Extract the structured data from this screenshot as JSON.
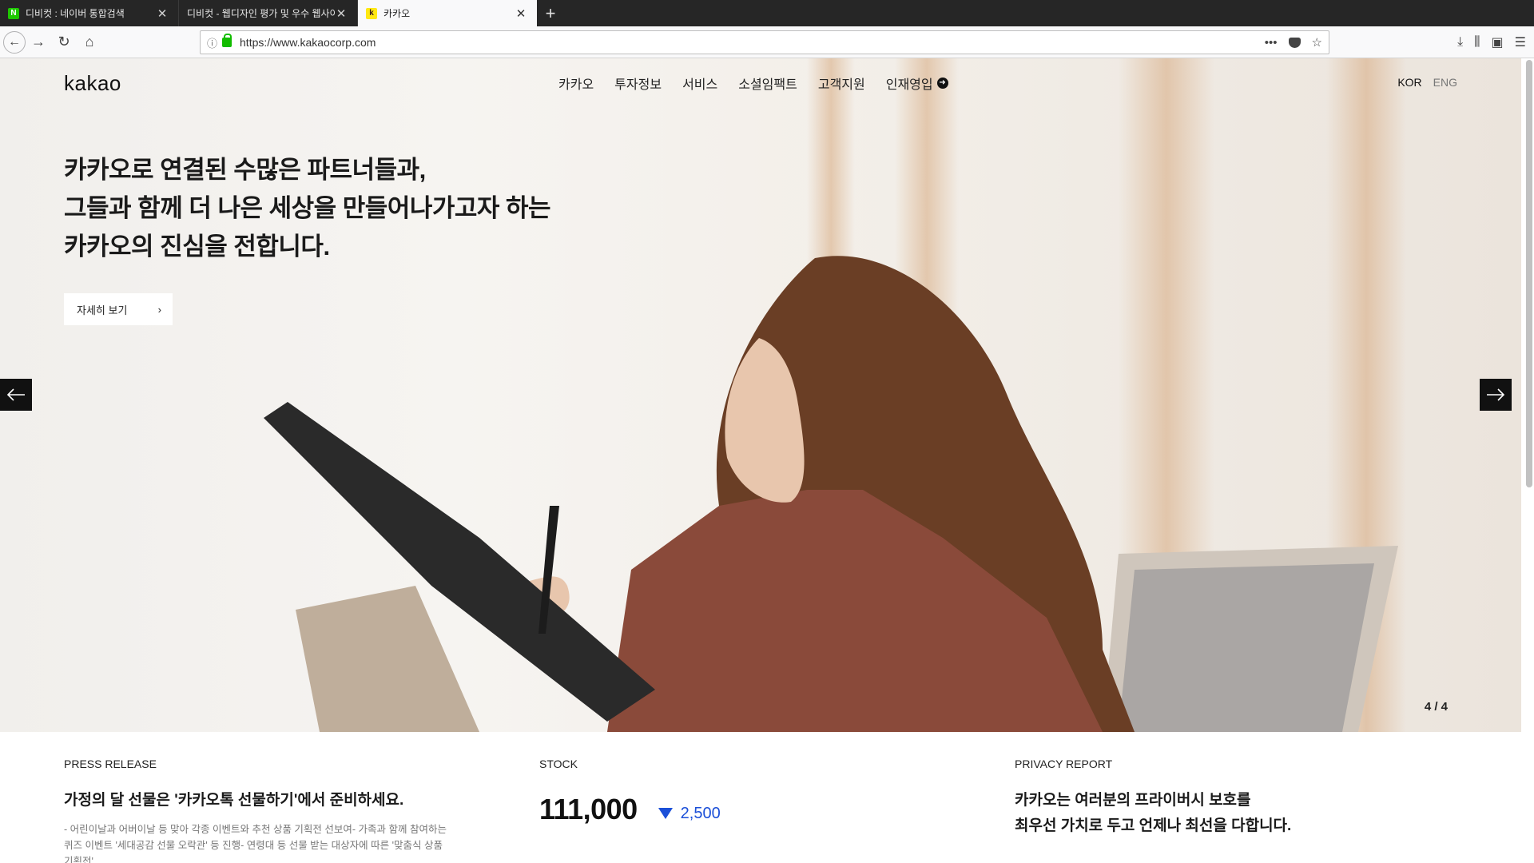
{
  "browser": {
    "tabs": [
      {
        "title": "디비컷 : 네이버 통합검색",
        "favicon": "N",
        "active": false
      },
      {
        "title": "디비컷 - 웹디자인 평가 및 우수 웹사이트",
        "favicon": "",
        "active": false
      },
      {
        "title": "카카오",
        "favicon": "k",
        "active": true
      }
    ],
    "url": "https://www.kakaocorp.com"
  },
  "header": {
    "logo": "kakao",
    "nav": [
      "카카오",
      "투자정보",
      "서비스",
      "소셜임팩트",
      "고객지원",
      "인재영입"
    ],
    "lang": {
      "kor": "KOR",
      "eng": "ENG"
    }
  },
  "hero": {
    "title_lines": [
      "카카오로 연결된 수많은 파트너들과,",
      "그들과 함께 더 나은 세상을 만들어나가고자 하는",
      "카카오의 진심을 전합니다."
    ],
    "detail_button": "자세히 보기",
    "pager": "4 / 4"
  },
  "press": {
    "label": "PRESS RELEASE",
    "headline": "가정의 달 선물은 '카카오톡 선물하기'에서 준비하세요.",
    "desc_lines": [
      "- 어린이날과 어버이날 등 맞아 각종 이벤트와 추천 상품 기획전 선보여- 가족과 함께 참여하는",
      "퀴즈 이벤트 '세대공감 선물 오락관' 등 진행- 연령대 등 선물 받는 대상자에 따른 '맞춤식 상품",
      "기획전'"
    ]
  },
  "stock": {
    "label": "STOCK",
    "price": "111,000",
    "change": "2,500",
    "change_color": "#1b4fd8"
  },
  "privacy": {
    "label": "PRIVACY REPORT",
    "headline_lines": [
      "카카오는 여러분의 프라이버시 보호를",
      "최우선 가치로 두고 언제나 최선을 다합니다."
    ]
  }
}
